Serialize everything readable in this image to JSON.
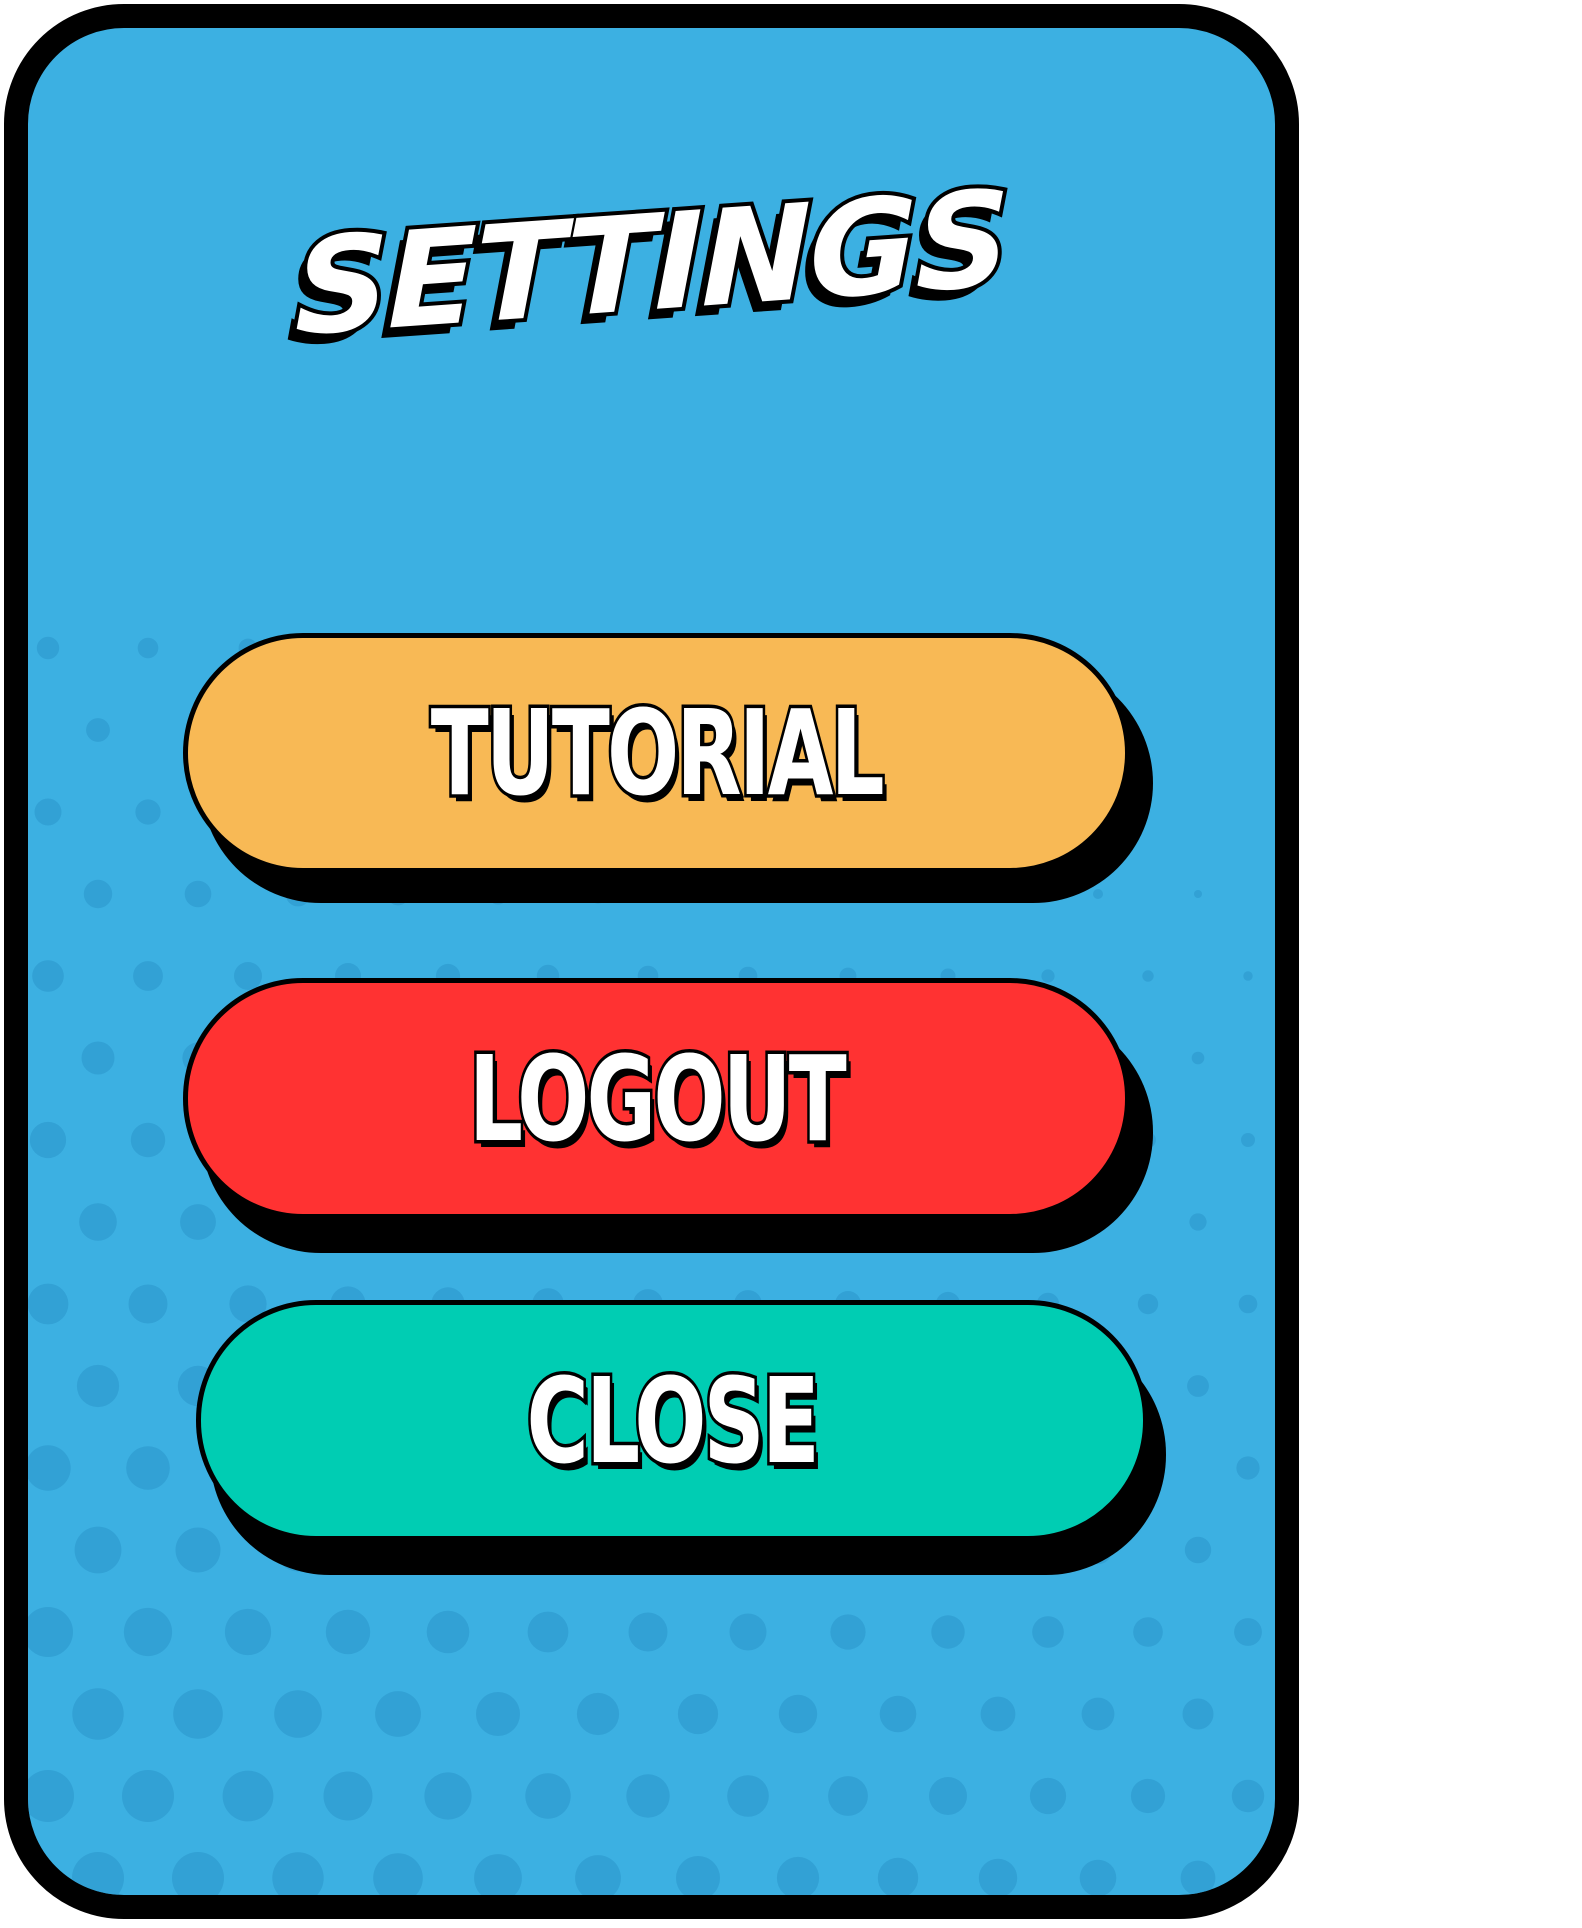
{
  "dialog": {
    "title": "SETTINGS",
    "background_color": "#3cb0e2",
    "border_color": "#000000"
  },
  "buttons": [
    {
      "id": "tutorial",
      "label": "TUTORIAL",
      "color": "#f8b955"
    },
    {
      "id": "logout",
      "label": "LOGOUT",
      "color": "#ff3232"
    },
    {
      "id": "close",
      "label": "CLOSE",
      "color": "#00cdb3"
    }
  ]
}
